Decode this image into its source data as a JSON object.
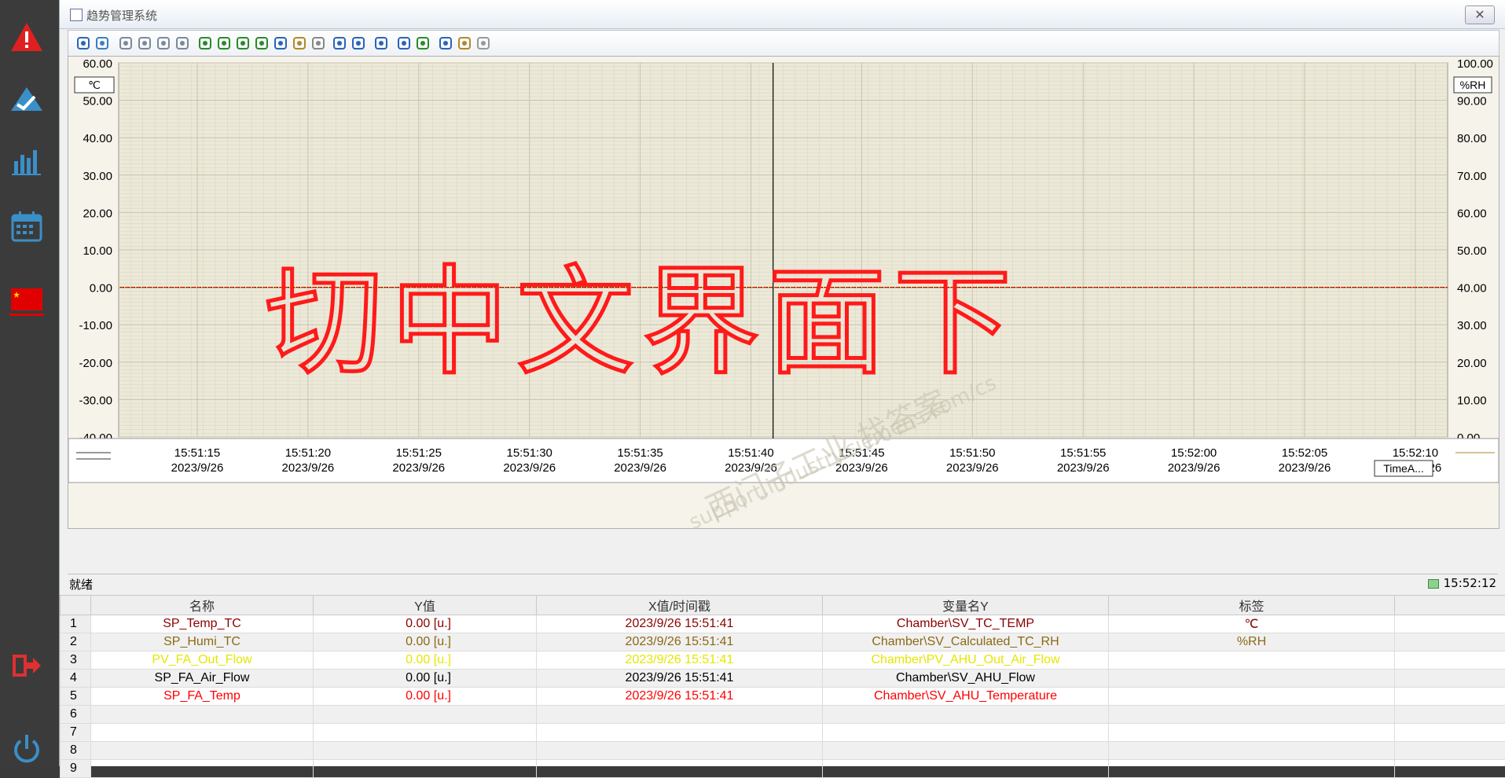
{
  "window": {
    "title": "趋势管理系统",
    "close_label": "✕"
  },
  "sidebar": {
    "icons": [
      "alarm-icon",
      "trend-check-icon",
      "bar-chart-icon",
      "calendar-icon",
      "china-flag-icon",
      "logout-icon",
      "power-icon"
    ]
  },
  "toolbar": {
    "icons": [
      "help-icon",
      "config-icon",
      "first-icon",
      "prev-icon",
      "next-icon",
      "last-icon",
      "zoom-area-icon",
      "zoom-in-icon",
      "zoom-out-icon",
      "zoom-time-icon",
      "move-icon",
      "zoom-value-icon",
      "original-view-icon",
      "ruler-icon",
      "select-area-icon",
      "pause-icon",
      "print-icon",
      "export-icon",
      "stat-area-icon",
      "stat-icon",
      "formula-icon"
    ]
  },
  "chart": {
    "left_unit": "℃",
    "right_unit": "%RH",
    "left_ticks": [
      "60.00",
      "50.00",
      "40.00",
      "30.00",
      "20.00",
      "10.00",
      "0.00",
      "-10.00",
      "-20.00",
      "-30.00",
      "-40.00"
    ],
    "right_ticks": [
      "100.00",
      "90.00",
      "80.00",
      "70.00",
      "60.00",
      "50.00",
      "40.00",
      "30.00",
      "20.00",
      "10.00",
      "0.00"
    ],
    "x_ticks": [
      {
        "time": "15:51:15",
        "date": "2023/9/26"
      },
      {
        "time": "15:51:20",
        "date": "2023/9/26"
      },
      {
        "time": "15:51:25",
        "date": "2023/9/26"
      },
      {
        "time": "15:51:30",
        "date": "2023/9/26"
      },
      {
        "time": "15:51:35",
        "date": "2023/9/26"
      },
      {
        "time": "15:51:40",
        "date": "2023/9/26"
      },
      {
        "time": "15:51:45",
        "date": "2023/9/26"
      },
      {
        "time": "15:51:50",
        "date": "2023/9/26"
      },
      {
        "time": "15:51:55",
        "date": "2023/9/26"
      },
      {
        "time": "15:52:00",
        "date": "2023/9/26"
      },
      {
        "time": "15:52:05",
        "date": "2023/9/26"
      },
      {
        "time": "15:52:10",
        "date": "2023/9/26"
      }
    ],
    "time_axis_label": "TimeA...",
    "annotation_text": "切中文界面下",
    "watermark_line1": "西门子工业 找答案",
    "watermark_line2": "support.industry.siemens.com/cs"
  },
  "chart_data": {
    "type": "line",
    "left_axis": {
      "unit": "℃",
      "ylim": [
        -40,
        60
      ]
    },
    "right_axis": {
      "unit": "%RH",
      "ylim": [
        0,
        100
      ]
    },
    "x_range": [
      "15:51:15",
      "15:52:10"
    ],
    "cursor_time": "15:51:41",
    "series": [
      {
        "name": "SP_Temp_TC",
        "color": "#8b0000",
        "values": [
          0,
          0
        ]
      },
      {
        "name": "SP_Humi_TC",
        "color": "#8b6914",
        "values": [
          0,
          0
        ]
      },
      {
        "name": "PV_FA_Out_Flow",
        "color": "#ffff00",
        "values": [
          0,
          0
        ]
      },
      {
        "name": "SP_FA_Air_Flow",
        "color": "#000000",
        "values": [
          0,
          0
        ]
      },
      {
        "name": "SP_FA_Temp",
        "color": "#ff0000",
        "values": [
          0,
          0
        ]
      }
    ],
    "grid": true
  },
  "status": {
    "left": "就绪",
    "right": "15:52:12"
  },
  "table": {
    "headers": [
      "名称",
      "Y值",
      "X值/时间戳",
      "变量名Y",
      "标签"
    ],
    "rows": [
      {
        "num": "1",
        "name": "SP_Temp_TC",
        "y": "0.00 [u.]",
        "x": "2023/9/26 15:51:41",
        "var": "Chamber\\SV_TC_TEMP",
        "tag": "℃",
        "color": "#8b0000"
      },
      {
        "num": "2",
        "name": "SP_Humi_TC",
        "y": "0.00 [u.]",
        "x": "2023/9/26 15:51:41",
        "var": "Chamber\\SV_Calculated_TC_RH",
        "tag": "%RH",
        "color": "#8b6914"
      },
      {
        "num": "3",
        "name": "PV_FA_Out_Flow",
        "y": "0.00 [u.]",
        "x": "2023/9/26 15:51:41",
        "var": "Chamber\\PV_AHU_Out_Air_Flow",
        "tag": "",
        "color": "#e6e600"
      },
      {
        "num": "4",
        "name": "SP_FA_Air_Flow",
        "y": "0.00 [u.]",
        "x": "2023/9/26 15:51:41",
        "var": "Chamber\\SV_AHU_Flow",
        "tag": "",
        "color": "#000000"
      },
      {
        "num": "5",
        "name": "SP_FA_Temp",
        "y": "0.00 [u.]",
        "x": "2023/9/26 15:51:41",
        "var": "Chamber\\SV_AHU_Temperature",
        "tag": "",
        "color": "#ff0000"
      },
      {
        "num": "6",
        "name": "",
        "y": "",
        "x": "",
        "var": "",
        "tag": "",
        "color": "#000"
      },
      {
        "num": "7",
        "name": "",
        "y": "",
        "x": "",
        "var": "",
        "tag": "",
        "color": "#000"
      },
      {
        "num": "8",
        "name": "",
        "y": "",
        "x": "",
        "var": "",
        "tag": "",
        "color": "#000"
      },
      {
        "num": "9",
        "name": "",
        "y": "",
        "x": "",
        "var": "",
        "tag": "",
        "color": "#000"
      }
    ]
  }
}
